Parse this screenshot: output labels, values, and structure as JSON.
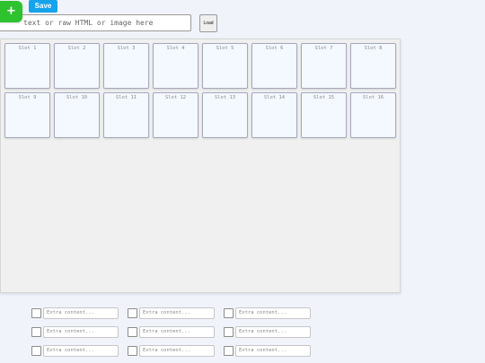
{
  "toolbar": {
    "add_label": "+",
    "save_label": "Save",
    "input_placeholder": "text or raw HTML or image here",
    "load_label": "Load"
  },
  "slots": [
    "Slot 1",
    "Slot 2",
    "Slot 3",
    "Slot 4",
    "Slot 5",
    "Slot 6",
    "Slot 7",
    "Slot 8",
    "Slot 9",
    "Slot 10",
    "Slot 11",
    "Slot 12",
    "Slot 13",
    "Slot 14",
    "Slot 15",
    "Slot 16"
  ],
  "extras": {
    "placeholder": "Extra content..."
  },
  "colors": {
    "add_button": "#2ec22e",
    "save_button": "#16a3ec",
    "page_background": "#f0f3fa"
  }
}
